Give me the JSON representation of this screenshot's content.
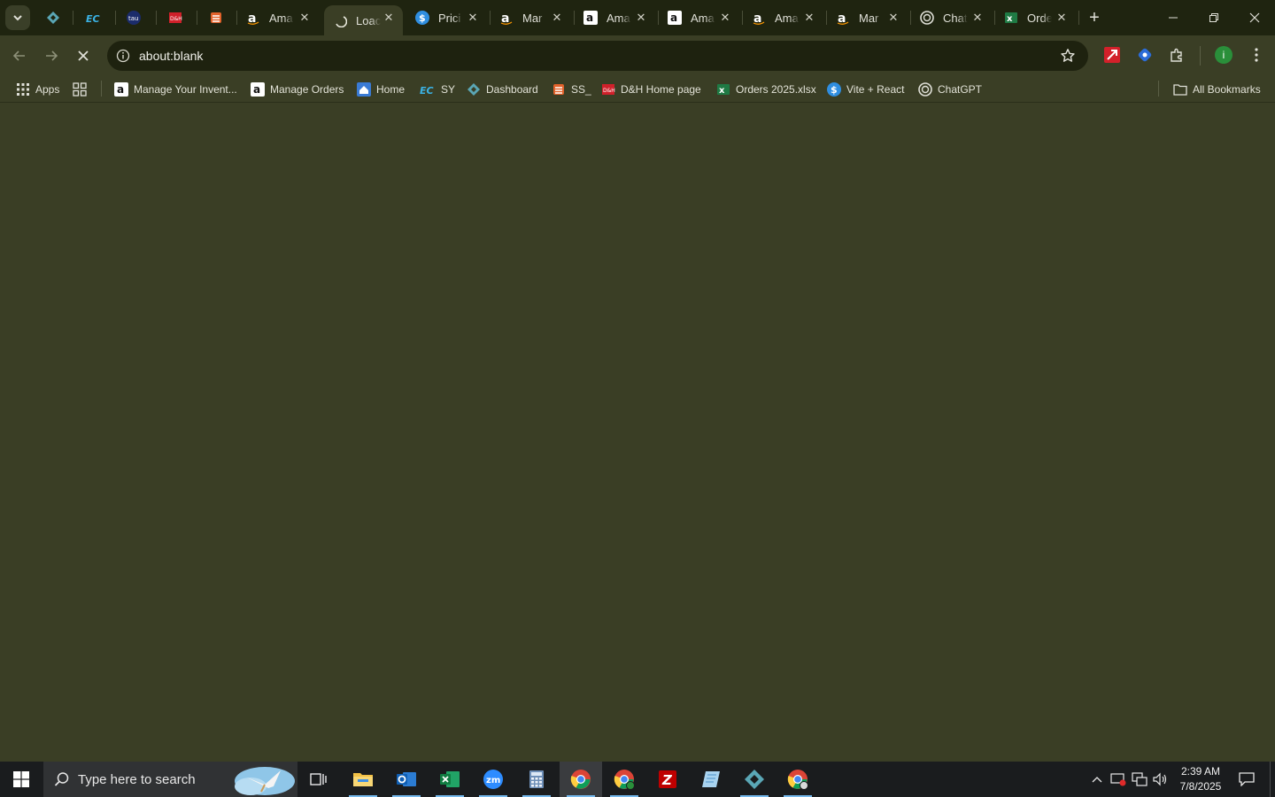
{
  "tabs": [
    {
      "title": "",
      "icon": "dashboard-diamond-icon",
      "closable": false
    },
    {
      "title": "",
      "icon": "ec-logo-icon",
      "closable": false
    },
    {
      "title": "",
      "icon": "tau-logo-icon",
      "closable": false
    },
    {
      "title": "",
      "icon": "dh-logo-icon",
      "closable": false
    },
    {
      "title": "",
      "icon": "ss-logo-icon",
      "closable": false
    },
    {
      "title": "Ama",
      "icon": "amazon-icon",
      "closable": true
    },
    {
      "title": "Loac",
      "icon": "loading-spinner-icon",
      "closable": true,
      "active": true
    },
    {
      "title": "Prici",
      "icon": "dollar-icon",
      "closable": true
    },
    {
      "title": "Mar",
      "icon": "amazon-icon",
      "closable": true
    },
    {
      "title": "Ama",
      "icon": "amazon-icon",
      "closable": true
    },
    {
      "title": "Ama",
      "icon": "amazon-icon",
      "closable": true
    },
    {
      "title": "Ama",
      "icon": "amazon-icon",
      "closable": true
    },
    {
      "title": "Mar",
      "icon": "amazon-icon",
      "closable": true
    },
    {
      "title": "Chat",
      "icon": "chatgpt-icon",
      "closable": true
    },
    {
      "title": "Orde",
      "icon": "excel-icon",
      "closable": true
    }
  ],
  "omnibox": {
    "url": "about:blank"
  },
  "bookmarks": [
    {
      "label": "Apps",
      "icon": "apps-grid-icon"
    },
    {
      "label": "",
      "icon": "tab-groups-icon"
    },
    {
      "label": "Manage Your Invent...",
      "icon": "amazon-icon"
    },
    {
      "label": "Manage Orders",
      "icon": "amazon-icon"
    },
    {
      "label": "Home",
      "icon": "home-site-icon"
    },
    {
      "label": "SY",
      "icon": "ec-logo-icon"
    },
    {
      "label": "Dashboard",
      "icon": "dashboard-diamond-icon"
    },
    {
      "label": "SS_",
      "icon": "ss-logo-icon"
    },
    {
      "label": "D&H Home page",
      "icon": "dh-logo-icon"
    },
    {
      "label": "Orders 2025.xlsx",
      "icon": "excel-icon"
    },
    {
      "label": "Vite + React",
      "icon": "dollar-icon"
    },
    {
      "label": "ChatGPT",
      "icon": "chatgpt-icon"
    }
  ],
  "all_bookmarks_label": "All Bookmarks",
  "profile_initial": "i",
  "taskbar": {
    "search_placeholder": "Type here to search",
    "time": "2:39 AM",
    "date": "7/8/2025"
  },
  "colors": {
    "frame": "#1f2410",
    "page_background": "#3a3e25",
    "omnibox": "#1e220f",
    "taskbar": "#1a1c1e"
  }
}
